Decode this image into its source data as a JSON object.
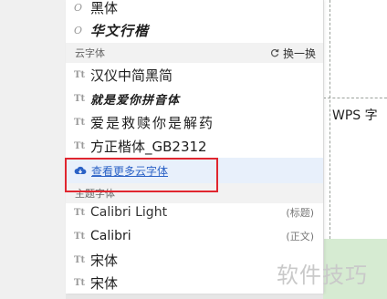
{
  "document": {
    "visible_text": "WPS 字"
  },
  "font_dropdown": {
    "recent_fonts": [
      {
        "name": "黑体",
        "glyph": "O"
      },
      {
        "name": "华文行楷",
        "glyph": "O"
      }
    ],
    "cloud_section": {
      "title": "云字体",
      "refresh_label": "换一换"
    },
    "cloud_fonts": [
      {
        "name": "汉仪中简黑简",
        "glyph": "Tt"
      },
      {
        "name": "就是爱你拼音体",
        "glyph": "Tt"
      },
      {
        "name": "爱是救赎你是解药",
        "glyph": "Tt"
      },
      {
        "name": "方正楷体_GB2312",
        "glyph": "Tt"
      }
    ],
    "more_link": "查看更多云字体",
    "theme_section": {
      "title": "主题字体"
    },
    "theme_fonts": [
      {
        "name": "Calibri Light",
        "tag": "(标题)",
        "glyph": "Tt"
      },
      {
        "name": "Calibri",
        "tag": "(正文)",
        "glyph": "Tt"
      },
      {
        "name": "宋体",
        "tag": "",
        "glyph": "Tt"
      },
      {
        "name": "宋体",
        "tag": "",
        "glyph": "Tt"
      }
    ]
  },
  "watermark": "软件技巧",
  "colors": {
    "highlight_border": "#e0262f",
    "link": "#2b62c6",
    "page_background": "#d6ebd2"
  }
}
